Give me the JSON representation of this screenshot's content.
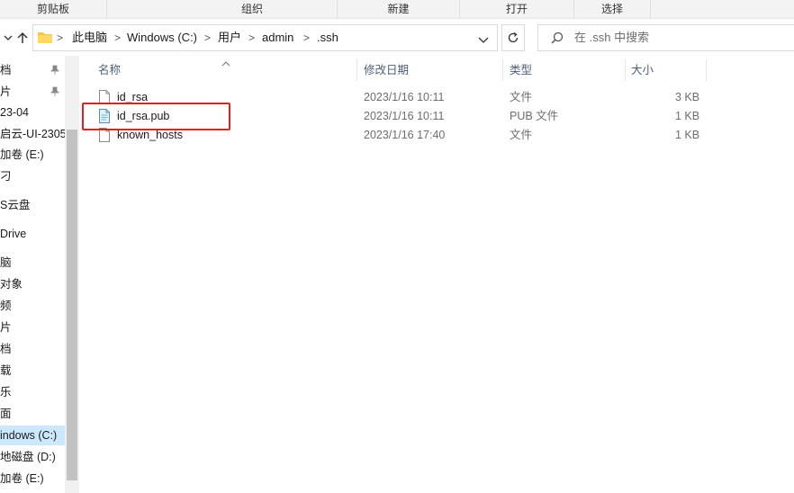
{
  "ribbon": {
    "groups": [
      "剪贴板",
      "组织",
      "新建",
      "打开",
      "选择"
    ]
  },
  "address": {
    "crumbs": [
      "此电脑",
      "Windows (C:)",
      "用户",
      "admin",
      ".ssh"
    ],
    "separator": ">"
  },
  "search": {
    "placeholder": "在 .ssh 中搜索"
  },
  "nav": {
    "items": [
      {
        "label": "档",
        "pinned": true
      },
      {
        "label": "片",
        "pinned": true
      },
      {
        "label": "23-04",
        "pinned": false
      },
      {
        "label": "启云-UI-2305",
        "pinned": false
      },
      {
        "label": "加卷 (E:)",
        "pinned": false
      },
      {
        "label": "刁",
        "pinned": false
      },
      {
        "label": "S云盘",
        "pinned": false
      },
      {
        "label": "Drive",
        "pinned": false
      },
      {
        "label": "脑",
        "pinned": false
      },
      {
        "label": "对象",
        "pinned": false
      },
      {
        "label": "频",
        "pinned": false
      },
      {
        "label": "片",
        "pinned": false
      },
      {
        "label": "档",
        "pinned": false
      },
      {
        "label": "载",
        "pinned": false
      },
      {
        "label": "乐",
        "pinned": false
      },
      {
        "label": "面",
        "pinned": false
      },
      {
        "label": "indows (C:)",
        "pinned": false,
        "selected": true
      },
      {
        "label": "地磁盘 (D:)",
        "pinned": false
      },
      {
        "label": "加卷 (E:)",
        "pinned": false
      }
    ]
  },
  "columns": {
    "name": "名称",
    "modified": "修改日期",
    "type": "类型",
    "size": "大小"
  },
  "files": [
    {
      "name": "id_rsa",
      "modified": "2023/1/16 10:11",
      "type": "文件",
      "size": "3 KB",
      "icon": "blank-file-icon"
    },
    {
      "name": "id_rsa.pub",
      "modified": "2023/1/16 10:11",
      "type": "PUB 文件",
      "size": "1 KB",
      "icon": "pub-file-icon"
    },
    {
      "name": "known_hosts",
      "modified": "2023/1/16 17:40",
      "type": "文件",
      "size": "1 KB",
      "icon": "blank-file-icon"
    }
  ],
  "colors": {
    "selected_nav": "#cce8ff",
    "header_text": "#4c607a",
    "highlight_box": "#e02020"
  }
}
